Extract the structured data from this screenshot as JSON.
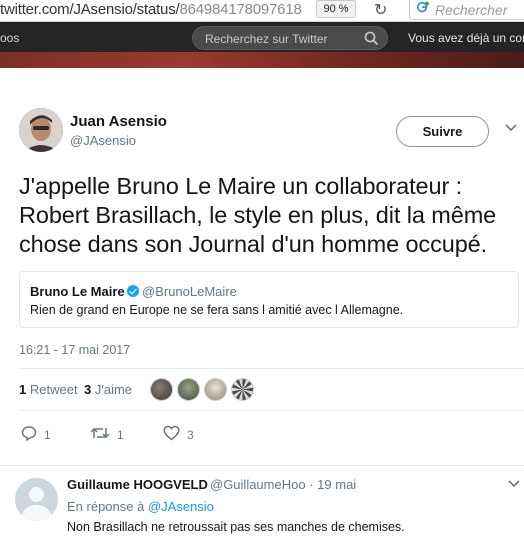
{
  "browser": {
    "url_main": "twitter.com/JAsensio/status/",
    "url_rest": "864984178097618",
    "zoom": "90 %",
    "search_placeholder": "Rechercher"
  },
  "twitter_header": {
    "nav_fragment": "oos",
    "search_placeholder": "Recherchez sur Twitter",
    "login_prompt": "Vous avez déjà un com"
  },
  "tweet": {
    "author_name": "Juan Asensio",
    "author_handle": "@JAsensio",
    "follow_label": "Suivre",
    "text": "J'appelle Bruno Le Maire un collaborateur : Robert Brasillach, le style en plus, dit la même chose dans son Journal d'un homme occupé.",
    "quote": {
      "name": "Bruno Le Maire",
      "handle": "@BrunoLeMaire",
      "text": "Rien de grand en Europe ne se fera sans l amitié avec l Allemagne."
    },
    "timestamp": "16:21 - 17 mai 2017",
    "retweet_count": "1",
    "retweet_label": "Retweet",
    "like_count": "3",
    "like_label": "J'aime",
    "actions": {
      "reply_count": "1",
      "retweet_count": "1",
      "like_count": "3"
    }
  },
  "reply": {
    "author_name": "Guillaume HOOGVELD",
    "author_handle": "@GuillaumeHoo",
    "separator": "·",
    "date": "19 mai",
    "in_reply_prefix": "En réponse à",
    "in_reply_handle": "@JAsensio",
    "text": "Non Brasillach ne retroussait pas ses manches de chemises."
  },
  "colors": {
    "accent": "#1da1f2",
    "link": "#1b95e0",
    "secondary_text": "#657786"
  }
}
